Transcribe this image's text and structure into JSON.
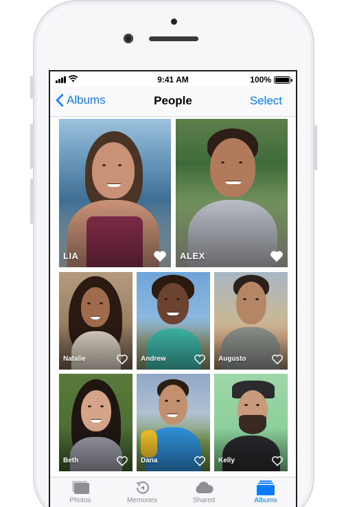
{
  "status_bar": {
    "time": "9:41 AM",
    "battery_percent": "100%",
    "battery_level": 1.0
  },
  "nav": {
    "back_label": "Albums",
    "title": "People",
    "action_label": "Select"
  },
  "people": [
    {
      "name": "LIA",
      "favorite": true
    },
    {
      "name": "ALEX",
      "favorite": true
    },
    {
      "name": "Natalie",
      "favorite": false
    },
    {
      "name": "Andrew",
      "favorite": false
    },
    {
      "name": "Augusto",
      "favorite": false
    },
    {
      "name": "Beth",
      "favorite": false
    },
    {
      "name": "Dana",
      "favorite": false
    },
    {
      "name": "Kelly",
      "favorite": false
    }
  ],
  "tab_bar": {
    "tabs": [
      {
        "label": "Photos",
        "icon": "photos-icon",
        "active": false
      },
      {
        "label": "Memories",
        "icon": "memories-icon",
        "active": false
      },
      {
        "label": "Shared",
        "icon": "cloud-icon",
        "active": false
      },
      {
        "label": "Albums",
        "icon": "albums-icon",
        "active": true
      }
    ]
  },
  "colors": {
    "accent": "#0a7aff",
    "inactive_tab": "#8e8e93"
  }
}
